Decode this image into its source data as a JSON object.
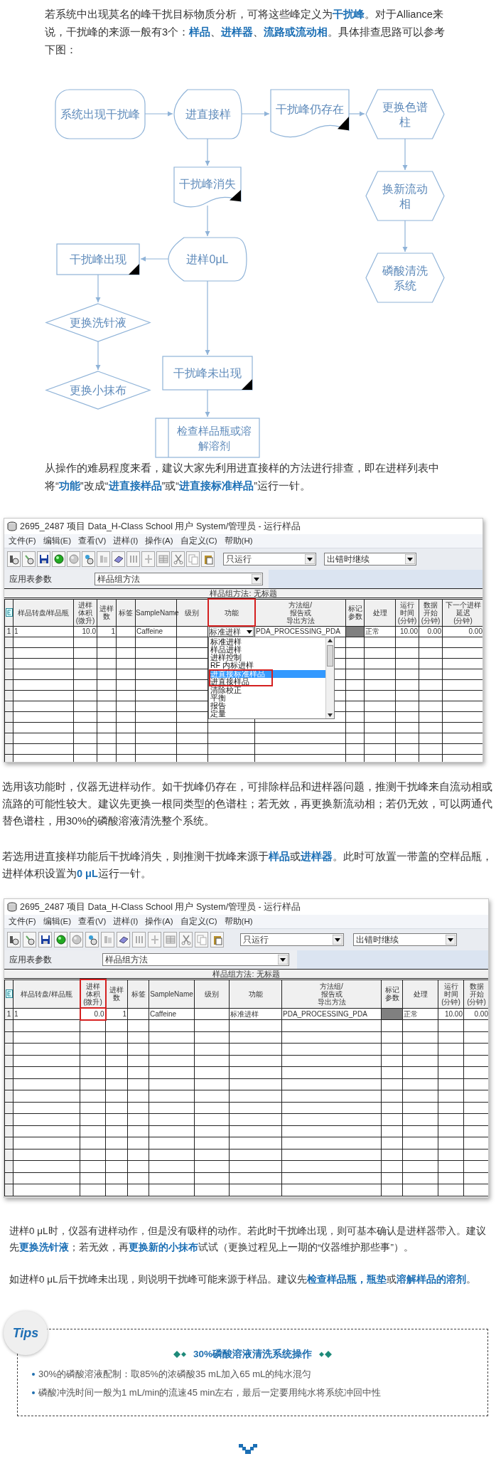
{
  "blocks": [
    {
      "kind": "paragraph",
      "text": "若系统中出现莫名的峰干扰目标物质分析，可将这些峰定义为**干扰峰**。对于Alliance来说，干扰峰的来源一般有3个：**样品**、**进样器**、**流路或流动相**。具体排查思路可以参考下图："
    },
    {
      "kind": "flowchart",
      "nodes": [
        {
          "kind": "terminal",
          "label": "系统出现干扰峰"
        },
        {
          "kind": "display",
          "label": "进直接样"
        },
        {
          "kind": "document",
          "label": "干扰峰仍存在"
        },
        {
          "kind": "hexagon",
          "label": "更换色谱柱"
        },
        {
          "kind": "document",
          "label": "干扰峰消失"
        },
        {
          "kind": "hexagon",
          "label": "换新流动相"
        },
        {
          "kind": "hexagon",
          "label": "磷酸清洗系统"
        },
        {
          "kind": "process",
          "label": "干扰峰出现"
        },
        {
          "kind": "display",
          "label": "进样0μL"
        },
        {
          "kind": "diamond",
          "label": "更换洗针液"
        },
        {
          "kind": "diamond",
          "label": "更换小抹布"
        },
        {
          "kind": "process",
          "label": "干扰峰未出现"
        },
        {
          "kind": "predefined",
          "label": "检查样品瓶或溶解溶剂"
        }
      ]
    },
    {
      "kind": "paragraph",
      "text": "从操作的难易程度来看，建议大家先利用进直接样的方法进行排查，即在进样列表中将“**功能**”改成“**进直接样品**”或“**进直接标准样品**”运行一针。"
    },
    {
      "kind": "window",
      "title": "2695_2487 项目 Data_H-Class School 用户 System/管理员 - 运行样品",
      "menu": [
        "文件(F)",
        "编辑(E)",
        "查看(V)",
        "进样(I)",
        "操作(A)",
        "自定义(C)",
        "帮助(H)"
      ],
      "run_mode": "只运行",
      "error_mode": "出错时继续",
      "params_label": "应用表参数",
      "params_value": "样品组方法",
      "group_title": "样品组方法: 无标题",
      "highlight_first_row": false,
      "columns": [
        {
          "lines": [
            "样品转盘/样品瓶"
          ],
          "kind": "text",
          "highlighted": false
        },
        {
          "lines": [
            "进样",
            "体积",
            "(微升)"
          ],
          "kind": "number",
          "highlighted": false
        },
        {
          "lines": [
            "进样",
            "数"
          ],
          "kind": "number",
          "highlighted": false
        },
        {
          "lines": [
            "标签"
          ],
          "kind": "text",
          "highlighted": false
        },
        {
          "lines": [
            "SampleName"
          ],
          "kind": "text",
          "highlighted": false
        },
        {
          "lines": [
            "级别"
          ],
          "kind": "text",
          "highlighted": false
        },
        {
          "lines": [
            "功能"
          ],
          "kind": "combo",
          "highlighted": true
        },
        {
          "lines": [
            "方法组/",
            "报告或",
            "导出方法"
          ],
          "kind": "text",
          "highlighted": false
        },
        {
          "lines": [
            "标记",
            "参数"
          ],
          "kind": "flag",
          "highlighted": false
        },
        {
          "lines": [
            "处理"
          ],
          "kind": "text",
          "highlighted": false
        },
        {
          "lines": [
            "运行",
            "时间",
            "(分钟)"
          ],
          "kind": "number",
          "highlighted": false
        },
        {
          "lines": [
            "数据",
            "开始",
            "(分钟)"
          ],
          "kind": "number",
          "highlighted": false
        },
        {
          "lines": [
            "下一个进样",
            "延迟",
            "(分钟)"
          ],
          "kind": "number",
          "highlighted": false
        }
      ],
      "rows": [
        {
          "number": "1",
          "cells": [
            "1",
            "10.0",
            "1",
            null,
            "Caffeine",
            null,
            "标准进样",
            "PDA_PROCESSING_PDA",
            null,
            "正常",
            "10.00",
            "0.00",
            "0.00"
          ]
        }
      ],
      "dropdown": {
        "items": [
          {
            "label": "标准进样",
            "selected": false,
            "outlined": false
          },
          {
            "label": "样品进样",
            "selected": false,
            "outlined": false
          },
          {
            "label": "进样控制",
            "selected": false,
            "outlined": false
          },
          {
            "label": "RF 内标进样",
            "selected": false,
            "outlined": false
          },
          {
            "label": "进直接标准样品",
            "selected": true,
            "outlined": true
          },
          {
            "label": "进直接样品",
            "selected": false,
            "outlined": true
          },
          {
            "label": "清除校正",
            "selected": false,
            "outlined": false
          },
          {
            "label": "平衡",
            "selected": false,
            "outlined": false
          },
          {
            "label": "报告",
            "selected": false,
            "outlined": false
          },
          {
            "label": "定量",
            "selected": false,
            "outlined": false
          }
        ]
      }
    },
    {
      "kind": "paragraph",
      "text": "选用该功能时，仪器无进样动作。如干扰峰仍存在，可排除样品和进样器问题，推测干扰峰来自流动相或流路的可能性较大。建议先更换一根同类型的色谱柱；若无效，再更换新流动相；若仍无效，可以两通代替色谱柱，用30%的磷酸溶液清洗整个系统。"
    },
    {
      "kind": "paragraph",
      "text": "若选用进直接样功能后干扰峰消失，则推测干扰峰来源于**样品**或**进样器**。此时可放置一带盖的空样品瓶，进样体积设置为**0 μL**运行一针。"
    },
    {
      "kind": "window",
      "title": "2695_2487 项目 Data_H-Class School 用户 System/管理员 - 运行样品",
      "menu": [
        "文件(F)",
        "编辑(E)",
        "查看(V)",
        "进样(I)",
        "操作(A)",
        "自定义(C)",
        "帮助(H)"
      ],
      "run_mode": "只运行",
      "error_mode": "出错时继续",
      "params_label": "应用表参数",
      "params_value": "样品组方法",
      "group_title": "样品组方法: 无标题",
      "highlight_first_row": true,
      "columns": [
        {
          "lines": [
            "样品转盘/样品瓶"
          ],
          "kind": "text",
          "highlighted": false
        },
        {
          "lines": [
            "进样",
            "体积",
            "(微升)"
          ],
          "kind": "number",
          "highlighted": true
        },
        {
          "lines": [
            "进样",
            "数"
          ],
          "kind": "number",
          "highlighted": false
        },
        {
          "lines": [
            "标签"
          ],
          "kind": "text",
          "highlighted": false
        },
        {
          "lines": [
            "SampleName"
          ],
          "kind": "text",
          "highlighted": false
        },
        {
          "lines": [
            "级别"
          ],
          "kind": "text",
          "highlighted": false
        },
        {
          "lines": [
            "功能"
          ],
          "kind": "text",
          "highlighted": false
        },
        {
          "lines": [
            "方法组/",
            "报告或",
            "导出方法"
          ],
          "kind": "text",
          "highlighted": false
        },
        {
          "lines": [
            "标记",
            "参数"
          ],
          "kind": "flag",
          "highlighted": false
        },
        {
          "lines": [
            "处理"
          ],
          "kind": "text",
          "highlighted": false
        },
        {
          "lines": [
            "运行",
            "时间",
            "(分钟)"
          ],
          "kind": "number",
          "highlighted": false
        },
        {
          "lines": [
            "数据",
            "开始",
            "(分钟)"
          ],
          "kind": "number",
          "highlighted": false
        }
      ],
      "rows": [
        {
          "number": "1",
          "cells": [
            "1",
            "0.0",
            "1",
            null,
            "Caffeine",
            null,
            "标准进样",
            "PDA_PROCESSING_PDA",
            null,
            "正常",
            "10.00",
            "0.00"
          ]
        }
      ]
    },
    {
      "kind": "paragraph",
      "text": "进样0 μL时，仪器有进样动作，但是没有吸样的动作。若此时干扰峰出现，则可基本确认是进样器带入。建议先**更换洗针液**；若无效，再**更换新的小抹布**试试（更换过程见上一期的“仪器维护那些事”）。"
    },
    {
      "kind": "paragraph",
      "text": "如进样0 μL后干扰峰未出现，则说明干扰峰可能来源于样品。建议先**检查样品瓶，瓶垫**或**溶解样品的溶剂**。"
    },
    {
      "kind": "tips",
      "badge": "Tips",
      "title": "30%磷酸溶液清洗系统操作",
      "items": [
        "30%的磷酸溶液配制：取85%的浓磷酸35 mL加入65 mL的纯水混匀",
        "磷酸冲洗时间一般为1 mL/min的流速45 min左右，最后一定要用纯水将系统冲回中性"
      ]
    }
  ]
}
